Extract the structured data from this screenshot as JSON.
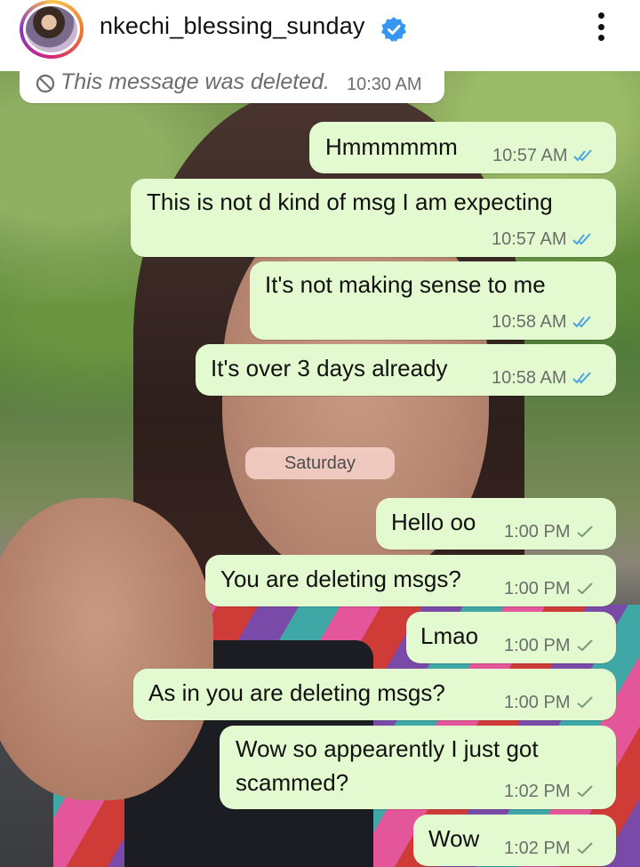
{
  "header": {
    "username": "nkechi_blessing_sunday",
    "verified_icon": "verified-badge-icon",
    "more_icon": "more-vertical-icon"
  },
  "colors": {
    "bubble": "#e3f9cf",
    "read_tick": "#4fa4e0",
    "sent_tick": "#7a9a7a",
    "verified": "#3797f0"
  },
  "chat": {
    "deleted_message": {
      "text": "This message was deleted.",
      "time": "10:30 AM"
    },
    "messages": [
      {
        "text": "Hmmmmmm",
        "time": "10:57 AM",
        "status": "read"
      },
      {
        "text": "This is not d kind of msg I am expecting",
        "time": "10:57 AM",
        "status": "read"
      },
      {
        "text": "It's not making sense to me",
        "time": "10:58 AM",
        "status": "read"
      },
      {
        "text": "It's over 3 days already",
        "time": "10:58 AM",
        "status": "read"
      },
      {
        "text": "Hello oo",
        "time": "1:00 PM",
        "status": "sent"
      },
      {
        "text": "You are deleting msgs?",
        "time": "1:00 PM",
        "status": "sent"
      },
      {
        "text": "Lmao",
        "time": "1:00 PM",
        "status": "sent"
      },
      {
        "text": "As in you are deleting msgs?",
        "time": "1:00 PM",
        "status": "sent"
      },
      {
        "text_line1": "Wow so appearently I just got",
        "text_line2": "scammed?",
        "time": "1:02 PM",
        "status": "sent"
      },
      {
        "text": "Wow",
        "time": "1:02 PM",
        "status": "sent"
      }
    ],
    "date_divider": "Saturday"
  }
}
